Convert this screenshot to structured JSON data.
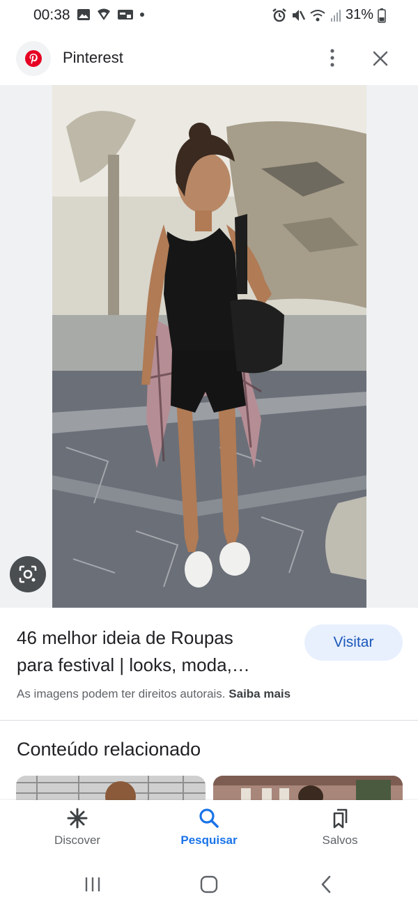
{
  "status_bar": {
    "time": "00:38",
    "battery": "31%"
  },
  "header": {
    "title": "Pinterest",
    "brand_color": "#e60023"
  },
  "result": {
    "title_line1": "46 melhor ideia de Roupas",
    "title_line2": "para festival | looks, moda,…",
    "visit_label": "Visitar",
    "copyright_text": "As imagens podem ter direitos autorais.",
    "learn_more_label": "Saiba mais"
  },
  "related": {
    "heading": "Conteúdo relacionado"
  },
  "bottom_nav": {
    "items": [
      {
        "label": "Discover",
        "icon": "asterisk-icon",
        "active": false
      },
      {
        "label": "Pesquisar",
        "icon": "search-icon",
        "active": true
      },
      {
        "label": "Salvos",
        "icon": "bookmarks-icon",
        "active": false
      }
    ],
    "active_color": "#1a73e8"
  },
  "system_nav": {
    "icons": [
      "recents-icon",
      "home-icon",
      "back-icon"
    ]
  }
}
